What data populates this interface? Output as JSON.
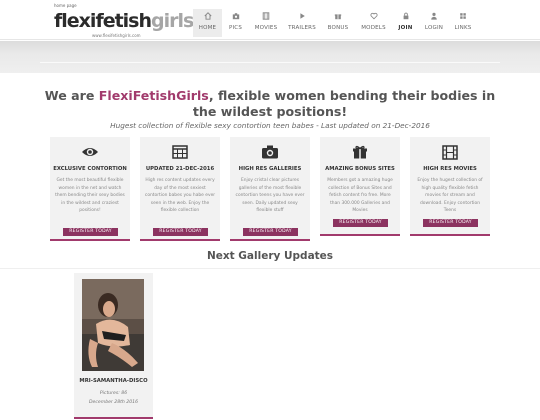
{
  "header": {
    "logo": {
      "tagline": "home page",
      "word1": "flexi",
      "word2": "fetish",
      "word3": "girls",
      "url": "www.flexifetishgirls.com"
    },
    "nav": [
      {
        "label": "HOME",
        "icon": "home-icon",
        "active": true
      },
      {
        "label": "PICS",
        "icon": "camera-icon"
      },
      {
        "label": "MOVIES",
        "icon": "film-icon"
      },
      {
        "label": "TRAILERS",
        "icon": "play-icon"
      },
      {
        "label": "BONUS",
        "icon": "gift-icon"
      },
      {
        "label": "MODELS",
        "icon": "heart-icon"
      },
      {
        "label": "JOIN",
        "icon": "lock-icon"
      },
      {
        "label": "LOGIN",
        "icon": "user-icon"
      },
      {
        "label": "LINKS",
        "icon": "grid-icon"
      }
    ]
  },
  "main": {
    "headline_prefix": "We are ",
    "headline_brand": "FlexiFetishGirls",
    "headline_suffix": ", flexible women bending their bodies in the wildest positions!",
    "subtitle": "Hugest collection of flexible sexy contortion teen babes - Last updated on 21-Dec-2016",
    "features": [
      {
        "icon": "eye-icon",
        "title": "EXCLUSIVE CONTORTION",
        "desc": "Get the most beautiful flexible women in the net and watch them bending their sexy bodies in the wildest and craziest positions!",
        "button": "REGISTER TODAY"
      },
      {
        "icon": "calendar-icon",
        "title": "UPDATED 21-DEC-2016",
        "desc": "High res content updates every day of the most sexiest contortion babes you habe ever seen in the web. Enjoy the flexible collection",
        "button": "REGISTER TODAY"
      },
      {
        "icon": "camera-icon",
        "title": "HIGH RES GALLERIES",
        "desc": "Enjoy cristal clear pictures galleries of the most flexible contortion teens you have ever seen. Daily updated sexy flexible stuff",
        "button": "REGISTER TODAY"
      },
      {
        "icon": "gift-icon",
        "title": "AMAZING BONUS SITES",
        "desc": "Members got a amazing huge collection of Bonus Sites and fetish content fro free. More than 300.000 Galleries and Movies",
        "button": "REGISTER TODAY"
      },
      {
        "icon": "film-icon",
        "title": "HIGH RES MOVIES",
        "desc": "Enjoy the hugest collection of high quality flexible fetish movies for stream and download. Enjoy contortion Teens",
        "button": "REGISTER TODAY"
      }
    ],
    "next_heading": "Next Gallery Updates",
    "gallery": [
      {
        "name": "MRI-SAMANTHA-DISCO",
        "pictures": "Pictures: 86",
        "date": "December 28th 2016"
      }
    ]
  },
  "colors": {
    "accent": "#a13a6c",
    "button": "#8c3360",
    "card_bg": "#f2f2f2"
  }
}
